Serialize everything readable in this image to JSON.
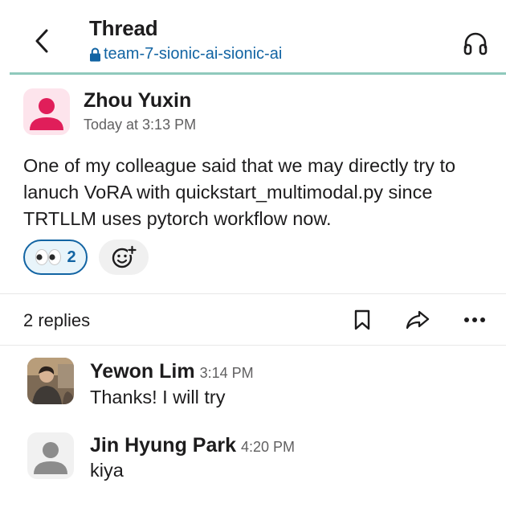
{
  "header": {
    "title": "Thread",
    "channel": "team-7-sionic-ai-sionic-ai"
  },
  "parent_message": {
    "author": "Zhou Yuxin",
    "timestamp": "Today at 3:13 PM",
    "text": "One of my colleague said that we may directly try to lanuch VoRA with quickstart_multimodal.py since TRTLLM uses pytorch workflow now.",
    "reactions": [
      {
        "emoji": "eyes",
        "count": "2"
      }
    ]
  },
  "actions": {
    "replies_count": "2 replies"
  },
  "replies": [
    {
      "author": "Yewon Lim",
      "time": "3:14 PM",
      "text": "Thanks! I will try"
    },
    {
      "author": "Jin Hyung Park",
      "time": "4:20 PM",
      "text": "kiya"
    }
  ],
  "colors": {
    "link": "#1264a3",
    "header_divider": "#8fc9bc",
    "avatar_pink": "#e01e5a",
    "avatar_gray": "#8c8c8c"
  }
}
